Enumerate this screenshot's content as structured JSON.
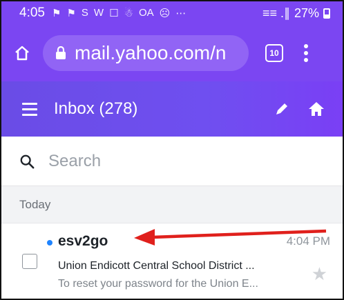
{
  "status_bar": {
    "time": "4:05",
    "notification_icons": [
      "⚑",
      "⚑",
      "S",
      "W",
      "☐",
      "☃",
      "OA",
      "☹",
      "⋯"
    ],
    "signal_text": "≡≡ .∥",
    "battery_percent": "27%"
  },
  "browser": {
    "url": "mail.yahoo.com/n",
    "tab_count": "10"
  },
  "app_header": {
    "title": "Inbox (278)"
  },
  "search": {
    "placeholder": "Search"
  },
  "section": {
    "label": "Today"
  },
  "messages": [
    {
      "sender": "esv2go",
      "time": "4:04 PM",
      "subject": "Union Endicott Central School District ...",
      "preview": "To reset your password for the Union E...",
      "unread": true
    }
  ],
  "colors": {
    "brand": "#7b46f2",
    "header_gradient": "#6a4ce6",
    "unread_dot": "#1f84ff",
    "annotation_arrow": "#e0201c"
  }
}
